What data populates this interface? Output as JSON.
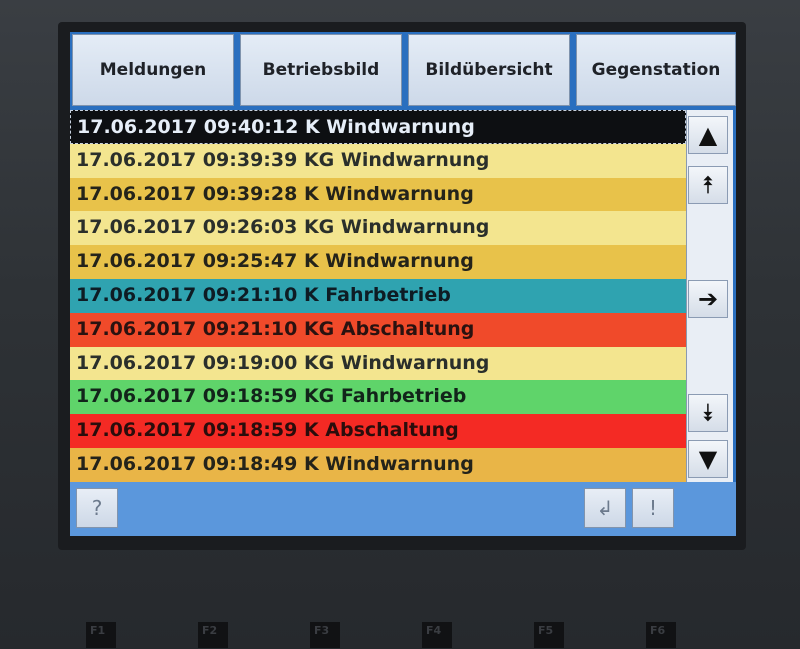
{
  "nav": {
    "meldungen": "Meldungen",
    "betriebsbild": "Betriebsbild",
    "bilduebersicht": "Bildübersicht",
    "gegenstation": "Gegenstation"
  },
  "messages": [
    {
      "text": "17.06.2017 09:40:12 K Windwarnung",
      "bg": "#0d0f12",
      "fg": "#e6eef8",
      "selected": true
    },
    {
      "text": "17.06.2017 09:39:39 KG Windwarnung",
      "bg": "#f3e58f",
      "fg": "#2a2f2b"
    },
    {
      "text": "17.06.2017 09:39:28 K Windwarnung",
      "bg": "#e8c24a",
      "fg": "#24231a"
    },
    {
      "text": "17.06.2017 09:26:03 KG Windwarnung",
      "bg": "#f3e58f",
      "fg": "#2a2f2b"
    },
    {
      "text": "17.06.2017 09:25:47 K Windwarnung",
      "bg": "#e8c24a",
      "fg": "#24231a"
    },
    {
      "text": "17.06.2017 09:21:10 K Fahrbetrieb",
      "bg": "#2fa3b0",
      "fg": "#0e1c24"
    },
    {
      "text": "17.06.2017 09:21:10 KG Abschaltung",
      "bg": "#f04a2a",
      "fg": "#2a1210"
    },
    {
      "text": "17.06.2017 09:19:00 KG Windwarnung",
      "bg": "#f3e58f",
      "fg": "#2a2f2b"
    },
    {
      "text": "17.06.2017 09:18:59 KG Fahrbetrieb",
      "bg": "#5fd46a",
      "fg": "#12241a"
    },
    {
      "text": "17.06.2017 09:18:59 K Abschaltung",
      "bg": "#f42a24",
      "fg": "#2a0d0c"
    },
    {
      "text": "17.06.2017 09:18:49 K Windwarnung",
      "bg": "#e9b547",
      "fg": "#24231a"
    }
  ],
  "scroll_icons": {
    "line_up": "▲",
    "page_up": "⯭",
    "enter": "➔",
    "page_down": "⯯",
    "line_down": "▼"
  },
  "footer": {
    "help": "?",
    "enter": "↲",
    "acknowledge": "!"
  },
  "fkeys": [
    "F1",
    "F2",
    "F3",
    "F4",
    "F5",
    "F6"
  ]
}
